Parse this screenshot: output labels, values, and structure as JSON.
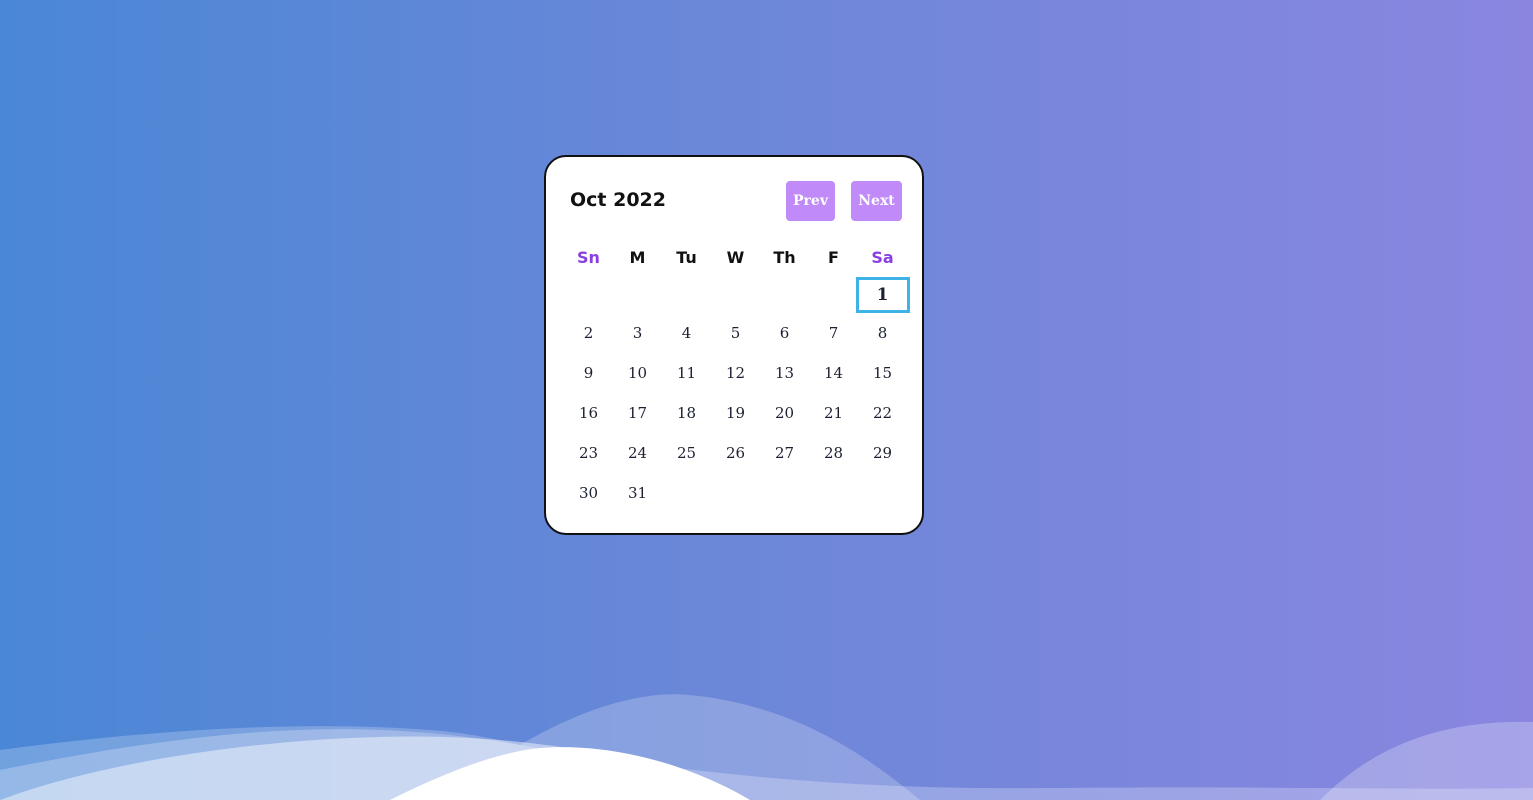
{
  "calendar": {
    "month_label": "Oct 2022",
    "prev_label": "Prev",
    "next_label": "Next",
    "weekdays": [
      "Sn",
      "M",
      "Tu",
      "W",
      "Th",
      "F",
      "Sa"
    ],
    "weekend_color": "#8a3fe0",
    "button_color": "#c08af8",
    "selected_border_color": "#3fb3e8",
    "selected_day": "1",
    "days": [
      "",
      "",
      "",
      "",
      "",
      "",
      "1",
      "2",
      "3",
      "4",
      "5",
      "6",
      "7",
      "8",
      "9",
      "10",
      "11",
      "12",
      "13",
      "14",
      "15",
      "16",
      "17",
      "18",
      "19",
      "20",
      "21",
      "22",
      "23",
      "24",
      "25",
      "26",
      "27",
      "28",
      "29",
      "30",
      "31"
    ]
  }
}
